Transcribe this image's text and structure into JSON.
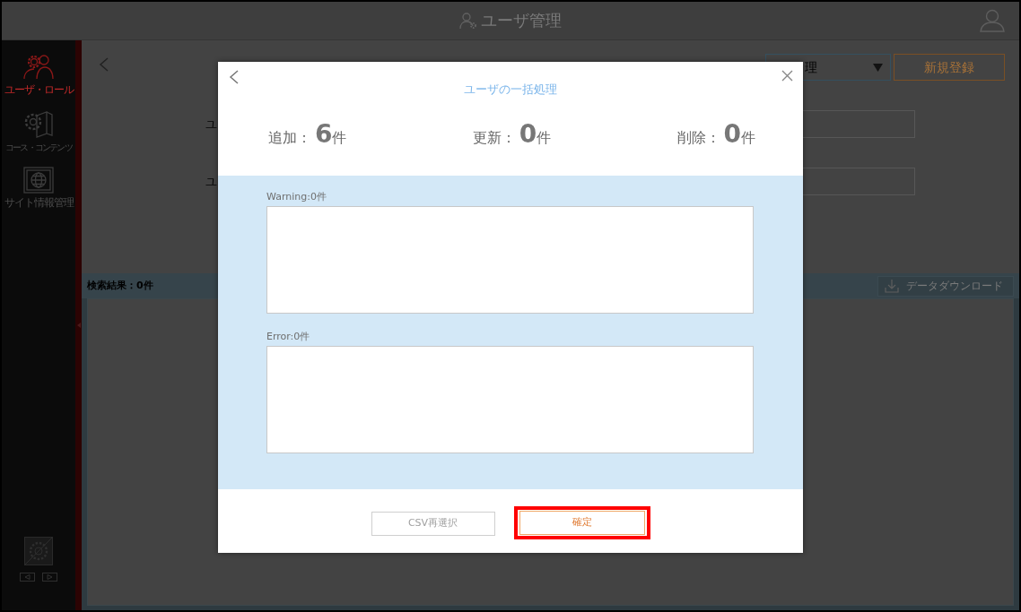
{
  "header": {
    "title": "ユーザ管理"
  },
  "sidebar": {
    "items": [
      {
        "label": "ユーザ・ロール",
        "selected": true
      },
      {
        "label": "コース・コンテンツ",
        "selected": false
      },
      {
        "label": "サイト情報管理",
        "selected": false
      }
    ]
  },
  "page": {
    "type_select": {
      "value": "理"
    },
    "new_button": "新規登録",
    "form_fields": [
      {
        "label": "ユ"
      },
      {
        "label": "ユ"
      }
    ],
    "results": {
      "count": "検索結果：0件",
      "download_button": "データダウンロード"
    }
  },
  "dialog": {
    "title": "ユーザの一括処理",
    "stats": [
      {
        "label": "追加：",
        "count": "6",
        "unit": "件"
      },
      {
        "label": "更新：",
        "count": "0",
        "unit": "件"
      },
      {
        "label": "削除：",
        "count": "0",
        "unit": "件"
      }
    ],
    "logs": [
      {
        "label": "Warning:0件"
      },
      {
        "label": "Error:0件"
      }
    ],
    "buttons": [
      {
        "label": "CSV再選択",
        "kind": "secondary",
        "highlighted": false
      },
      {
        "label": "確定",
        "kind": "primary",
        "highlighted": true
      }
    ]
  }
}
